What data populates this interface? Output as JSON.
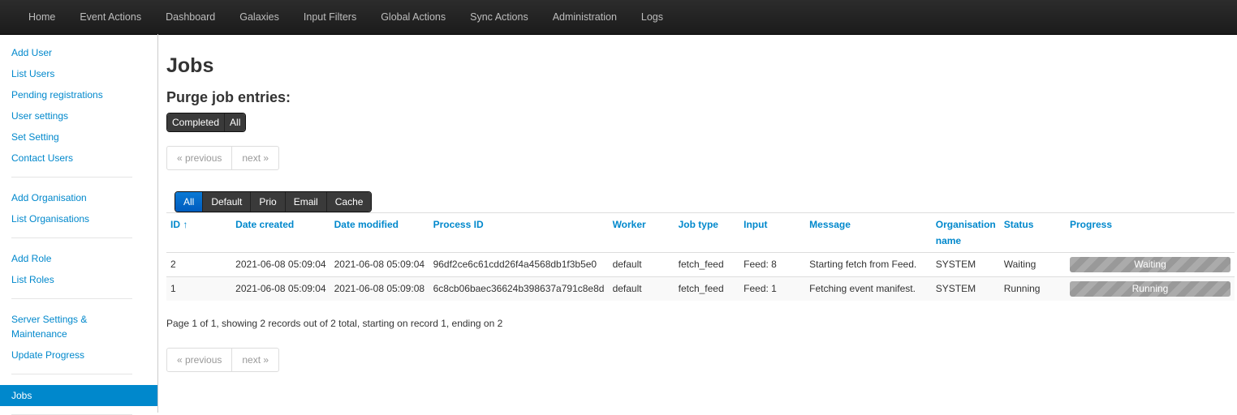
{
  "nav": [
    "Home",
    "Event Actions",
    "Dashboard",
    "Galaxies",
    "Input Filters",
    "Global Actions",
    "Sync Actions",
    "Administration",
    "Logs"
  ],
  "sidebar": {
    "group1": [
      "Add User",
      "List Users",
      "Pending registrations",
      "User settings",
      "Set Setting",
      "Contact Users"
    ],
    "group2": [
      "Add Organisation",
      "List Organisations"
    ],
    "group3": [
      "Add Role",
      "List Roles"
    ],
    "group4": [
      "Server Settings & Maintenance",
      "Update Progress"
    ],
    "active": "Jobs"
  },
  "page": {
    "title": "Jobs",
    "purge_heading": "Purge job entries:",
    "purge_buttons": [
      "Completed",
      "All"
    ],
    "prev_label": "« previous",
    "next_label": "next »",
    "filters": [
      "All",
      "Default",
      "Prio",
      "Email",
      "Cache"
    ],
    "summary": "Page 1 of 1, showing 2 records out of 2 total, starting on record 1, ending on 2"
  },
  "table": {
    "headers": [
      "ID ↑",
      "Date created",
      "Date modified",
      "Process ID",
      "Worker",
      "Job type",
      "Input",
      "Message",
      "Organisation name",
      "Status",
      "Progress"
    ],
    "rows": [
      {
        "id": "2",
        "created": "2021-06-08 05:09:04",
        "modified": "2021-06-08 05:09:04",
        "process_id": "96df2ce6c61cdd26f4a4568db1f3b5e0",
        "worker": "default",
        "job_type": "fetch_feed",
        "input": "Feed: 8",
        "message": "Starting fetch from Feed.",
        "org": "SYSTEM",
        "status": "Waiting",
        "progress_label": "Waiting"
      },
      {
        "id": "1",
        "created": "2021-06-08 05:09:04",
        "modified": "2021-06-08 05:09:08",
        "process_id": "6c8cb06baec36624b398637a791c8e8d",
        "worker": "default",
        "job_type": "fetch_feed",
        "input": "Feed: 1",
        "message": "Fetching event manifest.",
        "org": "SYSTEM",
        "status": "Running",
        "progress_label": "Running"
      }
    ]
  }
}
